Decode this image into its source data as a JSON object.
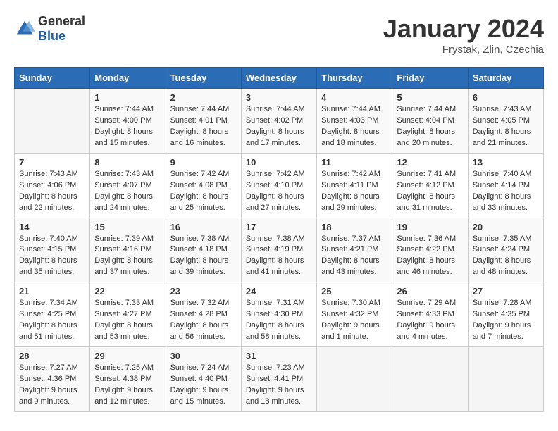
{
  "logo": {
    "general": "General",
    "blue": "Blue"
  },
  "header": {
    "title": "January 2024",
    "location": "Frystak, Zlin, Czechia"
  },
  "weekdays": [
    "Sunday",
    "Monday",
    "Tuesday",
    "Wednesday",
    "Thursday",
    "Friday",
    "Saturday"
  ],
  "weeks": [
    [
      {
        "day": "",
        "sunrise": "",
        "sunset": "",
        "daylight": ""
      },
      {
        "day": "1",
        "sunrise": "Sunrise: 7:44 AM",
        "sunset": "Sunset: 4:00 PM",
        "daylight": "Daylight: 8 hours and 15 minutes."
      },
      {
        "day": "2",
        "sunrise": "Sunrise: 7:44 AM",
        "sunset": "Sunset: 4:01 PM",
        "daylight": "Daylight: 8 hours and 16 minutes."
      },
      {
        "day": "3",
        "sunrise": "Sunrise: 7:44 AM",
        "sunset": "Sunset: 4:02 PM",
        "daylight": "Daylight: 8 hours and 17 minutes."
      },
      {
        "day": "4",
        "sunrise": "Sunrise: 7:44 AM",
        "sunset": "Sunset: 4:03 PM",
        "daylight": "Daylight: 8 hours and 18 minutes."
      },
      {
        "day": "5",
        "sunrise": "Sunrise: 7:44 AM",
        "sunset": "Sunset: 4:04 PM",
        "daylight": "Daylight: 8 hours and 20 minutes."
      },
      {
        "day": "6",
        "sunrise": "Sunrise: 7:43 AM",
        "sunset": "Sunset: 4:05 PM",
        "daylight": "Daylight: 8 hours and 21 minutes."
      }
    ],
    [
      {
        "day": "7",
        "sunrise": "Sunrise: 7:43 AM",
        "sunset": "Sunset: 4:06 PM",
        "daylight": "Daylight: 8 hours and 22 minutes."
      },
      {
        "day": "8",
        "sunrise": "Sunrise: 7:43 AM",
        "sunset": "Sunset: 4:07 PM",
        "daylight": "Daylight: 8 hours and 24 minutes."
      },
      {
        "day": "9",
        "sunrise": "Sunrise: 7:42 AM",
        "sunset": "Sunset: 4:08 PM",
        "daylight": "Daylight: 8 hours and 25 minutes."
      },
      {
        "day": "10",
        "sunrise": "Sunrise: 7:42 AM",
        "sunset": "Sunset: 4:10 PM",
        "daylight": "Daylight: 8 hours and 27 minutes."
      },
      {
        "day": "11",
        "sunrise": "Sunrise: 7:42 AM",
        "sunset": "Sunset: 4:11 PM",
        "daylight": "Daylight: 8 hours and 29 minutes."
      },
      {
        "day": "12",
        "sunrise": "Sunrise: 7:41 AM",
        "sunset": "Sunset: 4:12 PM",
        "daylight": "Daylight: 8 hours and 31 minutes."
      },
      {
        "day": "13",
        "sunrise": "Sunrise: 7:40 AM",
        "sunset": "Sunset: 4:14 PM",
        "daylight": "Daylight: 8 hours and 33 minutes."
      }
    ],
    [
      {
        "day": "14",
        "sunrise": "Sunrise: 7:40 AM",
        "sunset": "Sunset: 4:15 PM",
        "daylight": "Daylight: 8 hours and 35 minutes."
      },
      {
        "day": "15",
        "sunrise": "Sunrise: 7:39 AM",
        "sunset": "Sunset: 4:16 PM",
        "daylight": "Daylight: 8 hours and 37 minutes."
      },
      {
        "day": "16",
        "sunrise": "Sunrise: 7:38 AM",
        "sunset": "Sunset: 4:18 PM",
        "daylight": "Daylight: 8 hours and 39 minutes."
      },
      {
        "day": "17",
        "sunrise": "Sunrise: 7:38 AM",
        "sunset": "Sunset: 4:19 PM",
        "daylight": "Daylight: 8 hours and 41 minutes."
      },
      {
        "day": "18",
        "sunrise": "Sunrise: 7:37 AM",
        "sunset": "Sunset: 4:21 PM",
        "daylight": "Daylight: 8 hours and 43 minutes."
      },
      {
        "day": "19",
        "sunrise": "Sunrise: 7:36 AM",
        "sunset": "Sunset: 4:22 PM",
        "daylight": "Daylight: 8 hours and 46 minutes."
      },
      {
        "day": "20",
        "sunrise": "Sunrise: 7:35 AM",
        "sunset": "Sunset: 4:24 PM",
        "daylight": "Daylight: 8 hours and 48 minutes."
      }
    ],
    [
      {
        "day": "21",
        "sunrise": "Sunrise: 7:34 AM",
        "sunset": "Sunset: 4:25 PM",
        "daylight": "Daylight: 8 hours and 51 minutes."
      },
      {
        "day": "22",
        "sunrise": "Sunrise: 7:33 AM",
        "sunset": "Sunset: 4:27 PM",
        "daylight": "Daylight: 8 hours and 53 minutes."
      },
      {
        "day": "23",
        "sunrise": "Sunrise: 7:32 AM",
        "sunset": "Sunset: 4:28 PM",
        "daylight": "Daylight: 8 hours and 56 minutes."
      },
      {
        "day": "24",
        "sunrise": "Sunrise: 7:31 AM",
        "sunset": "Sunset: 4:30 PM",
        "daylight": "Daylight: 8 hours and 58 minutes."
      },
      {
        "day": "25",
        "sunrise": "Sunrise: 7:30 AM",
        "sunset": "Sunset: 4:32 PM",
        "daylight": "Daylight: 9 hours and 1 minute."
      },
      {
        "day": "26",
        "sunrise": "Sunrise: 7:29 AM",
        "sunset": "Sunset: 4:33 PM",
        "daylight": "Daylight: 9 hours and 4 minutes."
      },
      {
        "day": "27",
        "sunrise": "Sunrise: 7:28 AM",
        "sunset": "Sunset: 4:35 PM",
        "daylight": "Daylight: 9 hours and 7 minutes."
      }
    ],
    [
      {
        "day": "28",
        "sunrise": "Sunrise: 7:27 AM",
        "sunset": "Sunset: 4:36 PM",
        "daylight": "Daylight: 9 hours and 9 minutes."
      },
      {
        "day": "29",
        "sunrise": "Sunrise: 7:25 AM",
        "sunset": "Sunset: 4:38 PM",
        "daylight": "Daylight: 9 hours and 12 minutes."
      },
      {
        "day": "30",
        "sunrise": "Sunrise: 7:24 AM",
        "sunset": "Sunset: 4:40 PM",
        "daylight": "Daylight: 9 hours and 15 minutes."
      },
      {
        "day": "31",
        "sunrise": "Sunrise: 7:23 AM",
        "sunset": "Sunset: 4:41 PM",
        "daylight": "Daylight: 9 hours and 18 minutes."
      },
      {
        "day": "",
        "sunrise": "",
        "sunset": "",
        "daylight": ""
      },
      {
        "day": "",
        "sunrise": "",
        "sunset": "",
        "daylight": ""
      },
      {
        "day": "",
        "sunrise": "",
        "sunset": "",
        "daylight": ""
      }
    ]
  ]
}
